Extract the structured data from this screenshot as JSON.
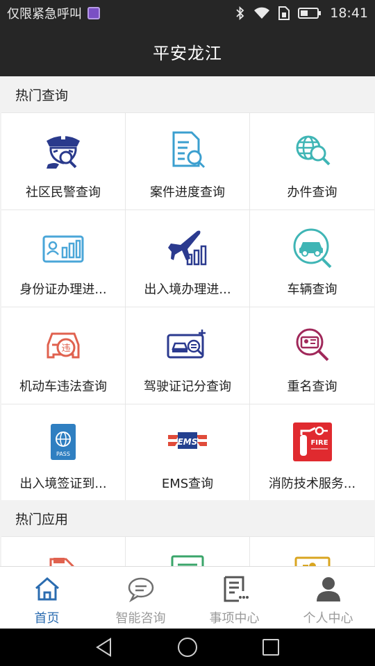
{
  "status_bar": {
    "carrier": "仅限紧急呼叫",
    "time": "18:41",
    "icons": [
      "bluetooth-icon",
      "wifi-icon",
      "sim-icon",
      "battery-icon"
    ]
  },
  "title": "平安龙江",
  "sections": {
    "hot_query": "热门查询",
    "hot_apps": "热门应用"
  },
  "hot_query_items": [
    {
      "label": "社区民警查询",
      "icon": "police-officer-icon"
    },
    {
      "label": "案件进度查询",
      "icon": "document-search-icon"
    },
    {
      "label": "办件查询",
      "icon": "globe-search-icon"
    },
    {
      "label": "身份证办理进...",
      "icon": "id-card-chart-icon"
    },
    {
      "label": "出入境办理进...",
      "icon": "airplane-chart-icon"
    },
    {
      "label": "车辆查询",
      "icon": "car-search-icon"
    },
    {
      "label": "机动车违法查询",
      "icon": "car-violation-icon"
    },
    {
      "label": "驾驶证记分查询",
      "icon": "license-points-icon"
    },
    {
      "label": "重名查询",
      "icon": "name-search-icon"
    },
    {
      "label": "出入境签证到...",
      "icon": "passport-icon"
    },
    {
      "label": "EMS查询",
      "icon": "ems-icon"
    },
    {
      "label": "消防技术服务...",
      "icon": "fire-extinguisher-icon"
    }
  ],
  "hot_app_items": [
    {
      "icon": "red-app-icon"
    },
    {
      "icon": "green-app-icon"
    },
    {
      "icon": "yellow-app-icon"
    }
  ],
  "tabs": [
    {
      "label": "首页",
      "icon": "home-icon",
      "active": true
    },
    {
      "label": "智能咨询",
      "icon": "chat-bubble-icon",
      "active": false
    },
    {
      "label": "事项中心",
      "icon": "list-document-icon",
      "active": false
    },
    {
      "label": "个人中心",
      "icon": "person-icon",
      "active": false
    }
  ],
  "colors": {
    "header_bg": "#262626",
    "active_tab": "#2b6cb0",
    "inactive_tab": "#9a9a9a"
  }
}
